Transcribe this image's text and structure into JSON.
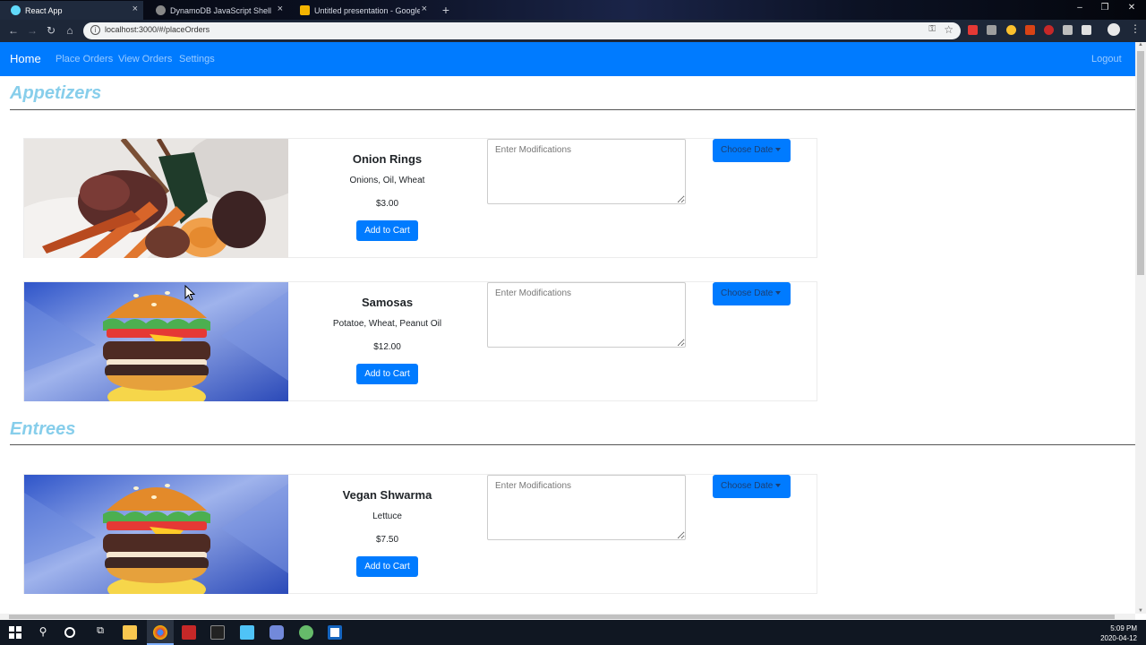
{
  "browser": {
    "tabs": [
      {
        "title": "React App",
        "active": true
      },
      {
        "title": "DynamoDB JavaScript Shell",
        "active": false
      },
      {
        "title": "Untitled presentation - Google Sl",
        "active": false
      }
    ],
    "url": "localhost:3000/#/placeOrders"
  },
  "nav": {
    "brand": "Home",
    "links": [
      "Place Orders",
      "View Orders",
      "Settings"
    ],
    "logout": "Logout"
  },
  "sections": [
    {
      "title": "Appetizers",
      "items": [
        {
          "name": "Onion Rings",
          "ingredients": "Onions, Oil, Wheat",
          "price": "$3.00",
          "add_label": "Add to Cart",
          "mods_placeholder": "Enter Modifications",
          "date_label": "Choose Date",
          "image": "skewer-food-photo"
        },
        {
          "name": "Samosas",
          "ingredients": "Potatoe, Wheat, Peanut Oil",
          "price": "$12.00",
          "add_label": "Add to Cart",
          "mods_placeholder": "Enter Modifications",
          "date_label": "Choose Date",
          "image": "burger-illustration"
        }
      ]
    },
    {
      "title": "Entrees",
      "items": [
        {
          "name": "Vegan Shwarma",
          "ingredients": "Lettuce",
          "price": "$7.50",
          "add_label": "Add to Cart",
          "mods_placeholder": "Enter Modifications",
          "date_label": "Choose Date",
          "image": "burger-illustration"
        }
      ]
    }
  ],
  "taskbar": {
    "time": "5:09 PM",
    "date": "2020-04-12"
  },
  "colors": {
    "navbar": "#007bff",
    "section_title": "#87ceeb",
    "button": "#007bff"
  }
}
